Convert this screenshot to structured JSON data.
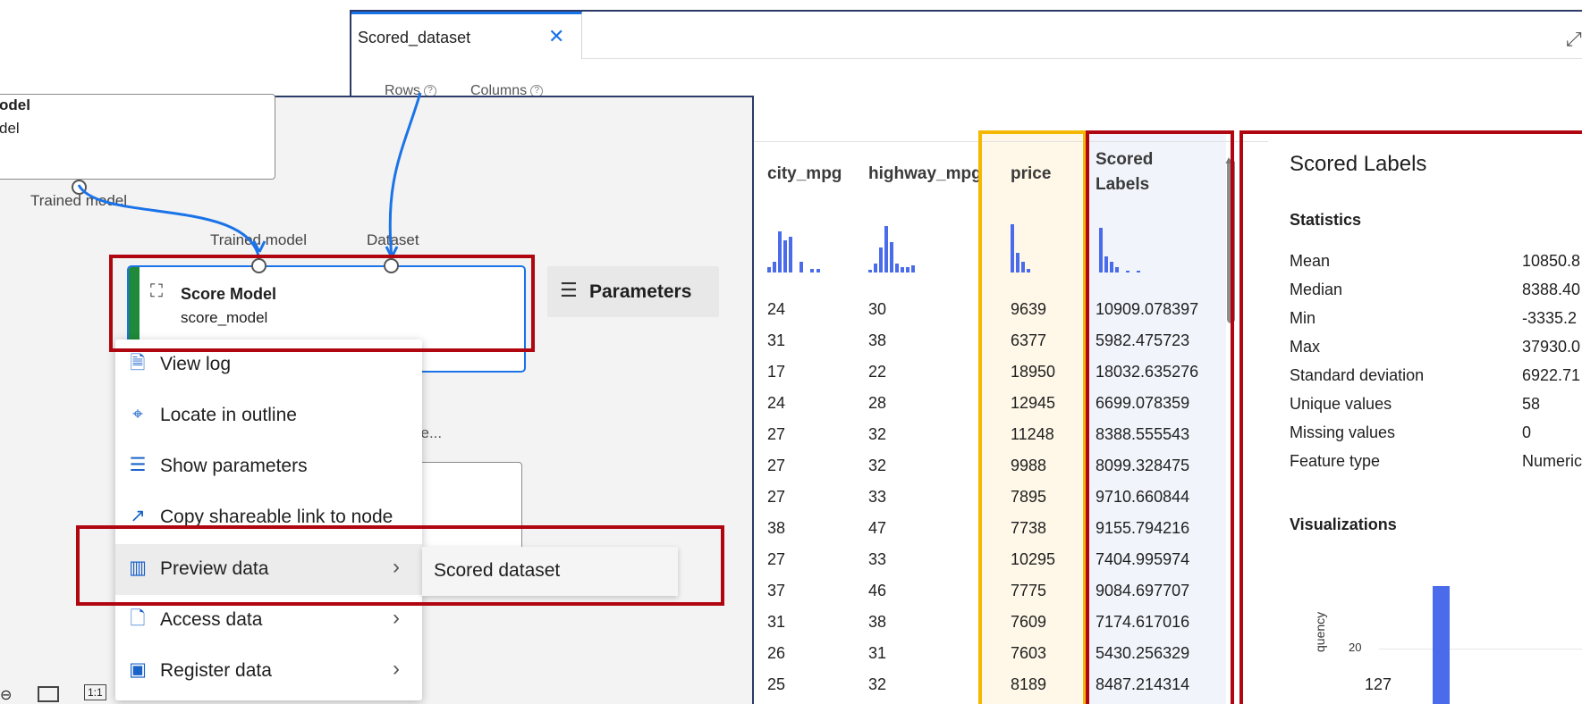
{
  "dataset_window": {
    "tab_label": "Scored_dataset",
    "close_glyph": "✕",
    "expand_glyph": "⤢",
    "rows_label": "Rows",
    "columns_label": "Columns",
    "help_glyph": "?"
  },
  "table": {
    "columns": [
      "city_mpg",
      "highway_mpg",
      "price",
      "Scored",
      "Labels"
    ],
    "rows": [
      [
        "24",
        "30",
        "9639",
        "10909.078397"
      ],
      [
        "31",
        "38",
        "6377",
        "5982.475723"
      ],
      [
        "17",
        "22",
        "18950",
        "18032.635276"
      ],
      [
        "24",
        "28",
        "12945",
        "6699.078359"
      ],
      [
        "27",
        "32",
        "11248",
        "8388.555543"
      ],
      [
        "27",
        "32",
        "9988",
        "8099.328475"
      ],
      [
        "27",
        "33",
        "7895",
        "9710.660844"
      ],
      [
        "38",
        "47",
        "7738",
        "9155.794216"
      ],
      [
        "27",
        "33",
        "10295",
        "7404.995974"
      ],
      [
        "37",
        "46",
        "7775",
        "9084.697707"
      ],
      [
        "31",
        "38",
        "7609",
        "7174.617016"
      ],
      [
        "26",
        "31",
        "7603",
        "5430.256329"
      ],
      [
        "25",
        "32",
        "8189",
        "8487.214314"
      ]
    ]
  },
  "stats": {
    "title": "Scored Labels",
    "heading": "Statistics",
    "items": [
      {
        "label": "Mean",
        "value": "10850.8"
      },
      {
        "label": "Median",
        "value": "8388.40"
      },
      {
        "label": "Min",
        "value": "-3335.2"
      },
      {
        "label": "Max",
        "value": "37930.0"
      },
      {
        "label": "Standard deviation",
        "value": "6922.71"
      },
      {
        "label": "Unique values",
        "value": "58"
      },
      {
        "label": "Missing values",
        "value": "0"
      },
      {
        "label": "Feature type",
        "value": "Numeric"
      }
    ],
    "viz_heading": "Visualizations",
    "viz_tick": "20",
    "viz_ylabel": "quency",
    "viz_count": "127"
  },
  "canvas": {
    "top_node_line1": "odel",
    "top_node_line2": "del",
    "trained_model_out": "Trained model",
    "score_in_trained": "Trained model",
    "score_in_dataset": "Dataset",
    "score_title": "Score Model",
    "score_sub": "score_model",
    "params_label": "Parameters",
    "hidden_node_text": "se...",
    "zoom_reset": "1:1"
  },
  "context_menu": {
    "items": [
      {
        "label": "View log",
        "icon": "document-icon"
      },
      {
        "label": "Locate in outline",
        "icon": "locate-icon"
      },
      {
        "label": "Show parameters",
        "icon": "sliders-icon"
      },
      {
        "label": "Copy shareable link to node",
        "icon": "share-icon"
      },
      {
        "label": "Preview data",
        "icon": "chart-icon"
      },
      {
        "label": "Access data",
        "icon": "file-lock-icon"
      },
      {
        "label": "Register data",
        "icon": "save-icon"
      }
    ],
    "submenu_label": "Scored dataset"
  }
}
